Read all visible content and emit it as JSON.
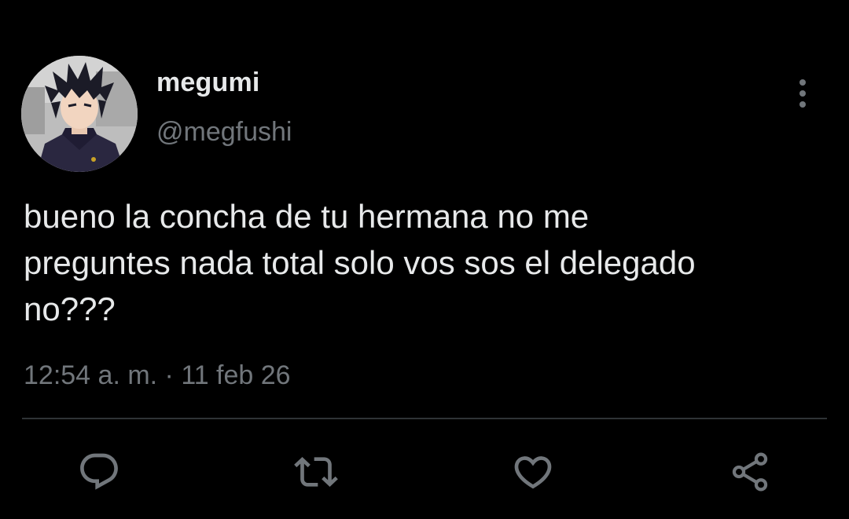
{
  "tweet": {
    "display_name": "megumi",
    "handle": "@megfushi",
    "text": "bueno la concha de tu hermana no me\npreguntes nada total solo vos sos el delegado\nno???",
    "timestamp": "12:54 a. m. · 11 feb 26"
  },
  "icons": {
    "more": "more-vertical-icon",
    "reply": "reply-icon",
    "retweet": "retweet-icon",
    "like": "heart-icon",
    "share": "share-icon"
  },
  "colors": {
    "background": "#000000",
    "primary_text": "#e7e9ea",
    "secondary_text": "#71767b",
    "divider": "#2f3336"
  }
}
